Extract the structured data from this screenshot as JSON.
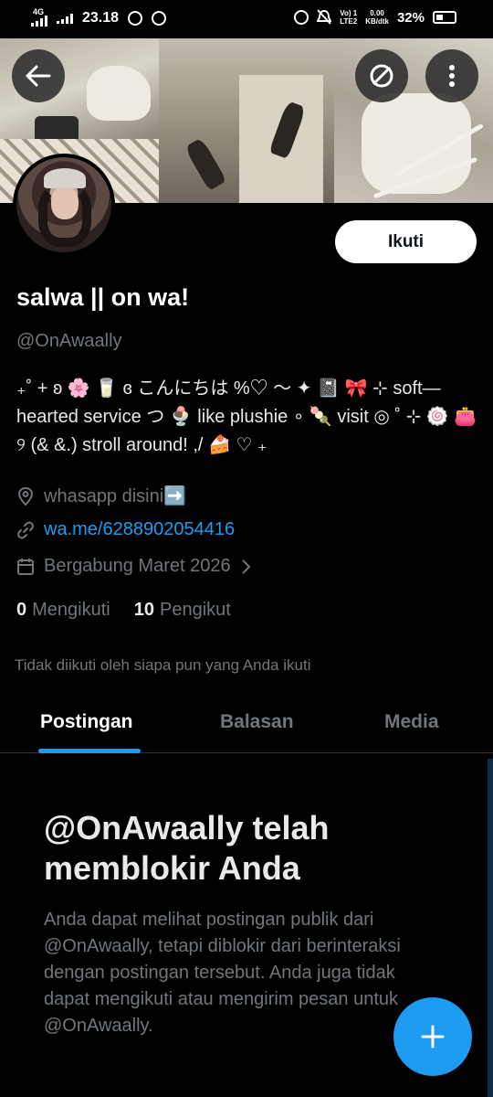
{
  "status_bar": {
    "network": "4G",
    "time": "23.18",
    "volte": "Vo) 1\nLTE2",
    "speed": "0.00\nKB/dtk",
    "battery": "32%"
  },
  "header": {
    "back_icon": "arrow-left-icon",
    "mute_icon": "circle-slash-icon",
    "more_icon": "more-vertical-icon"
  },
  "profile": {
    "follow_label": "Ikuti",
    "display_name": "salwa || on wa!",
    "handle": "@OnAwaally",
    "bio": "₊˚ + ʚ 🌸 🥛 ɞ こんにちは %♡ 〜 ✦ 📓 🎀 ⊹ soft—hearted service つ 🍨 like plushie ∘ 🍡 visit ◎ ˚ ⊹ 🍥 👛 ୨ (& &.) stroll around! ,/ 🍰 ♡ ₊",
    "location": "whasapp disini➡️",
    "link": "wa.me/6288902054416",
    "joined": "Bergabung Maret 2026",
    "following_count": "0",
    "following_label": "Mengikuti",
    "followers_count": "10",
    "followers_label": "Pengikut",
    "followed_by_notice": "Tidak diikuti oleh siapa pun yang Anda ikuti"
  },
  "tabs": [
    {
      "label": "Postingan",
      "active": true
    },
    {
      "label": "Balasan",
      "active": false
    },
    {
      "label": "Media",
      "active": false
    }
  ],
  "blocked": {
    "title": "@OnAwaally telah memblokir Anda",
    "body": "Anda dapat melihat postingan publik dari @OnAwaally, tetapi diblokir dari berinteraksi dengan postingan tersebut. Anda juga tidak dapat mengikuti atau mengirim pesan untuk @OnAwaally."
  },
  "fab": {
    "icon": "plus-icon"
  },
  "colors": {
    "accent": "#1d9bf0",
    "background": "#000000",
    "secondary_text": "#71767b"
  }
}
